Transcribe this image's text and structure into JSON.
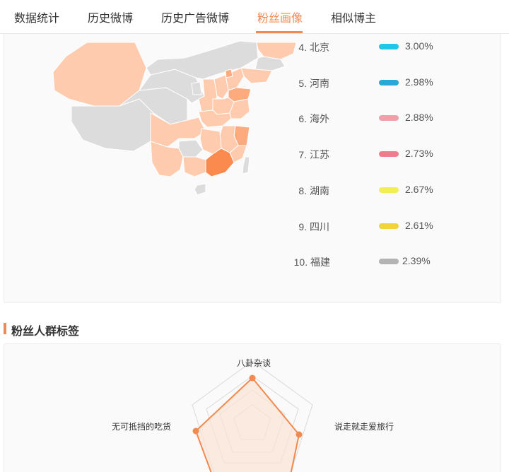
{
  "tabs": [
    {
      "label": "数据统计",
      "active": false
    },
    {
      "label": "历史微博",
      "active": false
    },
    {
      "label": "历史广告微博",
      "active": false
    },
    {
      "label": "粉丝画像",
      "active": true
    },
    {
      "label": "相似博主",
      "active": false
    }
  ],
  "colors": {
    "accent": "#f28a4f",
    "map_light": "#ffcbae",
    "map_mid": "#fdaa7f",
    "map_dark": "#fb8a4f",
    "map_empty": "#dcdcdc"
  },
  "region_ranking": [
    {
      "label": "4. 北京",
      "percent": "3.00%",
      "color": "#1fc8e6"
    },
    {
      "label": "5. 河南",
      "percent": "2.98%",
      "color": "#28a9d6"
    },
    {
      "label": "6. 海外",
      "percent": "2.88%",
      "color": "#f0a0a8"
    },
    {
      "label": "7. 江苏",
      "percent": "2.73%",
      "color": "#ee7d8e"
    },
    {
      "label": "8. 湖南",
      "percent": "2.67%",
      "color": "#f3ee52"
    },
    {
      "label": "9. 四川",
      "percent": "2.61%",
      "color": "#efd43c"
    },
    {
      "label": "10. 福建",
      "percent": "2.39%",
      "color": "#b4b4b4"
    }
  ],
  "fan_tags": {
    "title": "粉丝人群标签",
    "radar_labels": [
      "八卦杂谈",
      "说走就走爱旅行",
      "无可抵挡的吃货"
    ]
  }
}
